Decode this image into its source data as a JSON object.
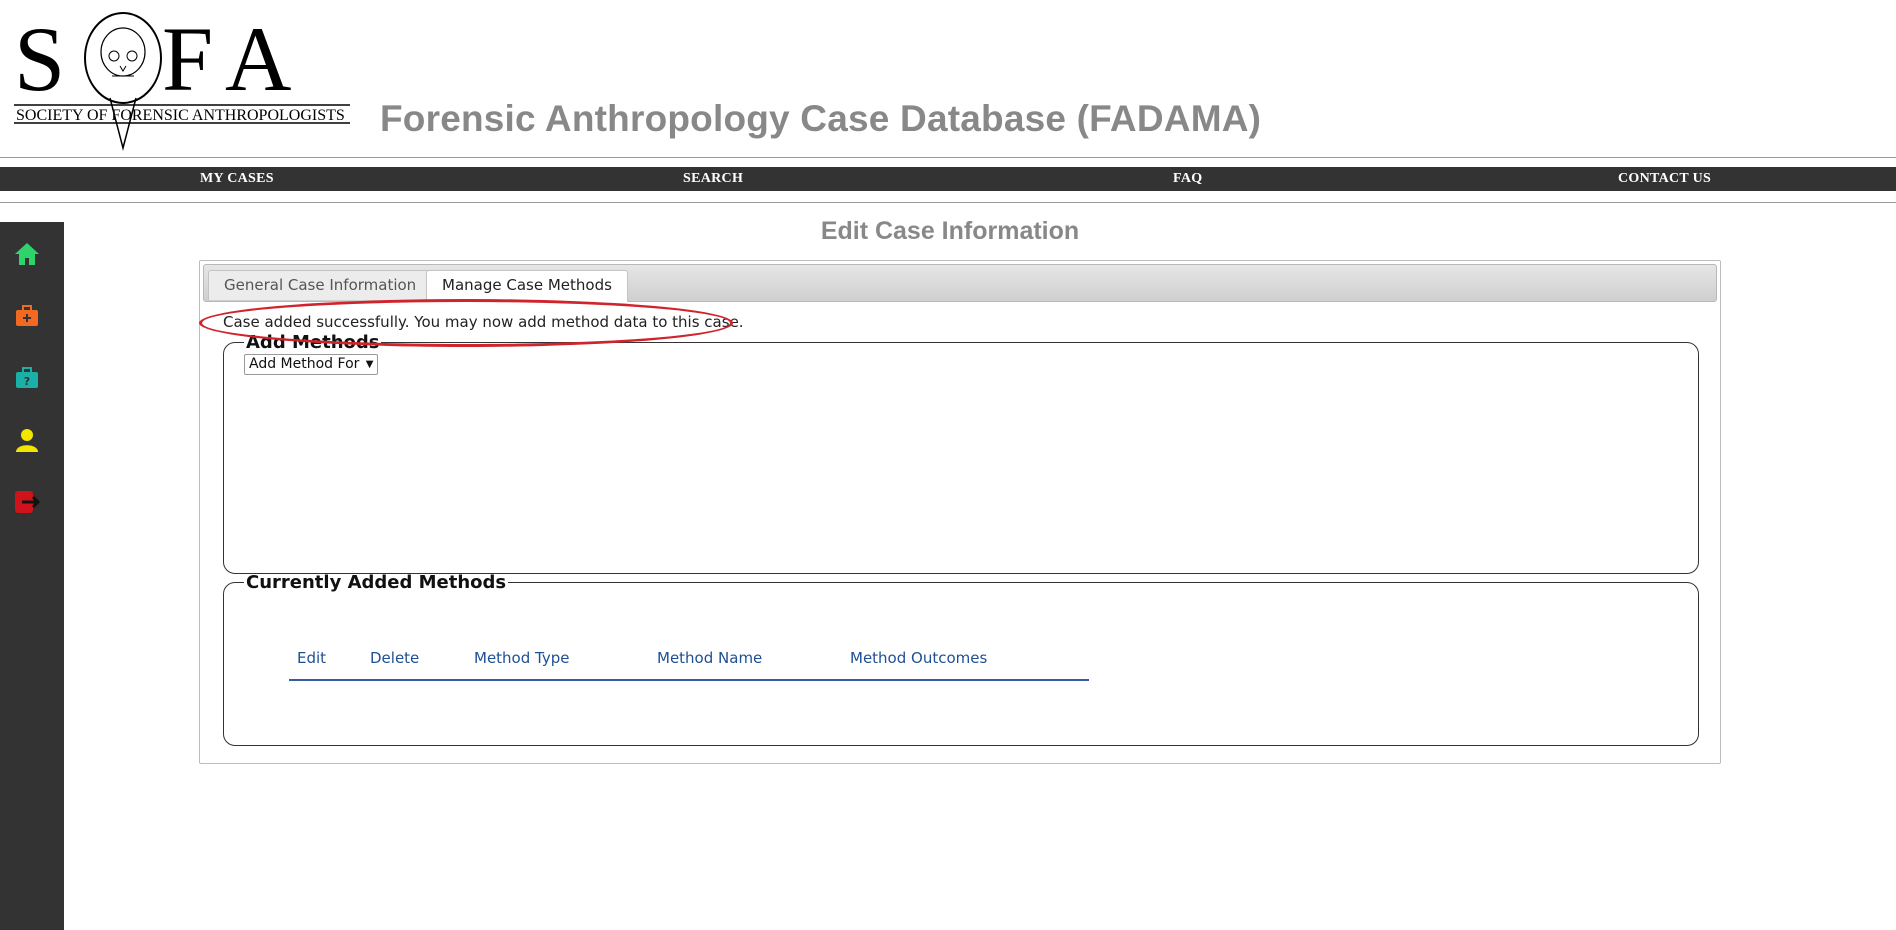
{
  "header": {
    "logo_text": "SOCIETY OF FORENSIC ANTHROPOLOGISTS",
    "logo_letters": "SOFA",
    "site_title": "Forensic Anthropology Case Database (FADAMA)"
  },
  "topnav": {
    "items": [
      "MY CASES",
      "SEARCH",
      "FAQ",
      "CONTACT US"
    ]
  },
  "sidebar": {
    "icons": [
      {
        "name": "home-icon",
        "color": "#2fd36b"
      },
      {
        "name": "add-case-icon",
        "color": "#f26a21"
      },
      {
        "name": "case-help-icon",
        "color": "#1ab0a8"
      },
      {
        "name": "user-icon",
        "color": "#f2e600"
      },
      {
        "name": "logout-icon",
        "color": "#d0121b"
      }
    ]
  },
  "main": {
    "page_title": "Edit Case Information",
    "tabs": [
      {
        "label": "General Case Information",
        "active": false
      },
      {
        "label": "Manage Case Methods",
        "active": true
      }
    ],
    "success_message": "Case added successfully. You may now add method data to this case.",
    "add_methods": {
      "legend": "Add Methods",
      "select_value": "Add Method For"
    },
    "current_methods": {
      "legend": "Currently Added Methods",
      "columns": [
        "Edit",
        "Delete",
        "Method Type",
        "Method Name",
        "Method Outcomes"
      ]
    }
  },
  "colors": {
    "nav_bg": "#333333",
    "title_gray": "#888888",
    "highlight_red": "#d0242d",
    "table_header_blue": "#1f4f95"
  }
}
